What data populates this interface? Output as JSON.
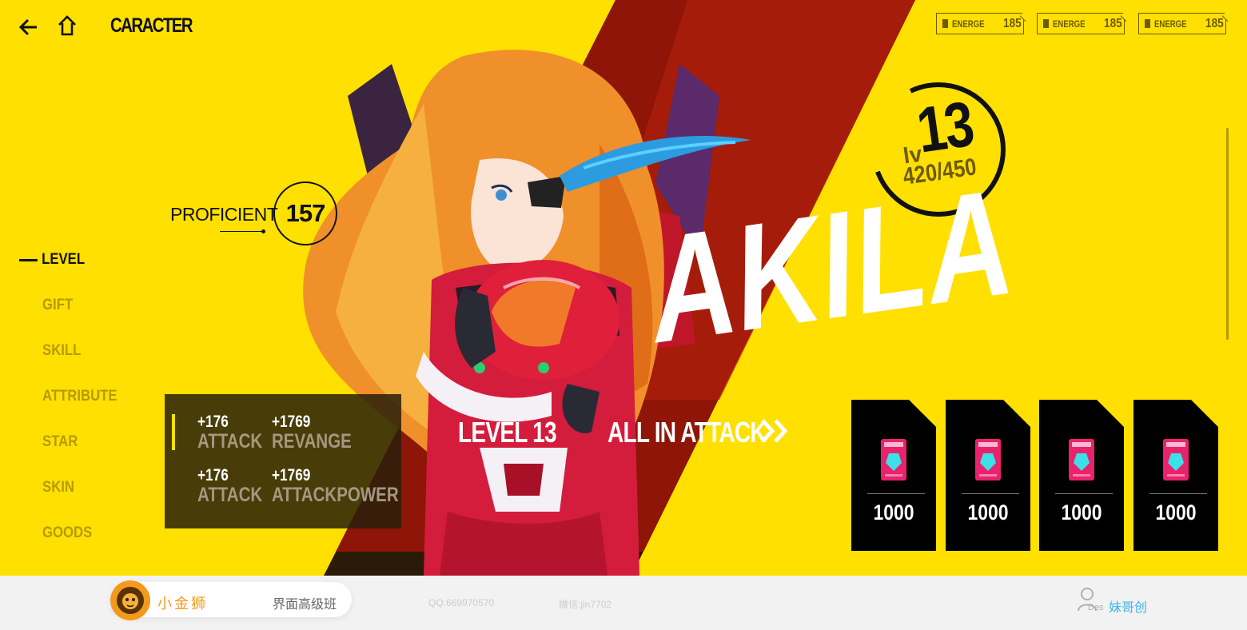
{
  "nav": {
    "title": "CARACTER"
  },
  "energy": [
    {
      "label": "ENERGE",
      "value": "185"
    },
    {
      "label": "ENERGE",
      "value": "185"
    },
    {
      "label": "ENERGE",
      "value": "185"
    }
  ],
  "proficient": {
    "label": "PROFICIENT",
    "value": "157"
  },
  "menu": [
    {
      "label": "LEVEL",
      "active": true
    },
    {
      "label": "GIFT"
    },
    {
      "label": "SKILL"
    },
    {
      "label": "ATTRIBUTE"
    },
    {
      "label": "STAR"
    },
    {
      "label": "SKIN"
    },
    {
      "label": "GOODS"
    }
  ],
  "stats": [
    {
      "num": "+176",
      "name": "ATTACK"
    },
    {
      "num": "+1769",
      "name": "REVANGE"
    },
    {
      "num": "+176",
      "name": "ATTACK"
    },
    {
      "num": "+1769",
      "name": "ATTACKPOWER"
    }
  ],
  "character": {
    "name": "AKILA",
    "lv_prefix": "lv",
    "level": "13",
    "xp": "420/450",
    "xp_fraction": 0.933,
    "level_caption": "LEVEL  13",
    "action": "ALL IN ATTACK"
  },
  "cards": [
    {
      "value": "1000"
    },
    {
      "value": "1000"
    },
    {
      "value": "1000"
    },
    {
      "value": "1000"
    }
  ],
  "footer": {
    "brand": "小金狮",
    "course": "界面高级班",
    "qq": "QQ:669970570",
    "wechat": "微信:jin7702",
    "des_label": "Des",
    "author": "妹哥创"
  },
  "colors": {
    "background": "#FFE000",
    "band_red": "#9e1a0a",
    "menu_inactive": "#b59a00",
    "brand_orange": "#f39a1e",
    "author_blue": "#3ab7e8"
  }
}
